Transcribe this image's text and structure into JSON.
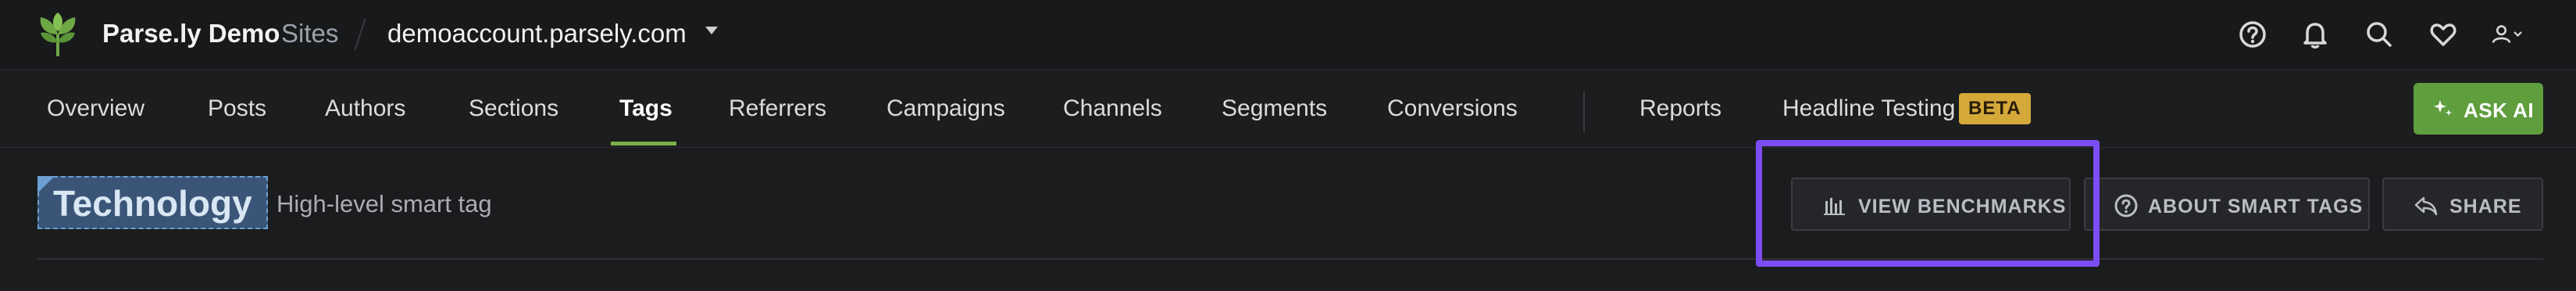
{
  "header": {
    "brand": "Parse.ly Demo",
    "sites_label": "Sites",
    "account": "demoaccount.parsely.com",
    "icons": [
      "help-icon",
      "bell-icon",
      "search-icon",
      "heart-icon",
      "user-icon"
    ]
  },
  "nav": {
    "items": [
      {
        "label": "Overview"
      },
      {
        "label": "Posts"
      },
      {
        "label": "Authors"
      },
      {
        "label": "Sections"
      },
      {
        "label": "Tags"
      },
      {
        "label": "Referrers"
      },
      {
        "label": "Campaigns"
      },
      {
        "label": "Channels"
      },
      {
        "label": "Segments"
      },
      {
        "label": "Conversions"
      },
      {
        "label": "Reports"
      },
      {
        "label": "Headline Testing"
      }
    ],
    "active": "Tags",
    "beta_badge": "BETA",
    "ask_ai_label": "ASK AI"
  },
  "page": {
    "tag_name": "Technology",
    "tag_subtitle": "High-level smart tag",
    "buttons": {
      "view_benchmarks": "VIEW BENCHMARKS",
      "about_smart_tags": "ABOUT SMART TAGS",
      "share": "SHARE"
    }
  },
  "colors": {
    "accent_green": "#7bb04a",
    "ask_ai_green": "#5f9e3d",
    "beta_gold": "#d4a93a",
    "highlight_purple": "#7b4df5",
    "tag_blue": "#3a5577"
  }
}
